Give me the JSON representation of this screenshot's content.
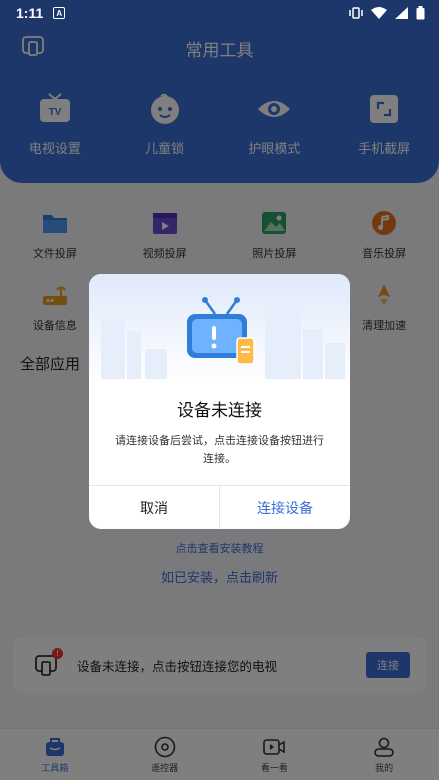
{
  "status": {
    "time": "1:11"
  },
  "header": {
    "title": "常用工具",
    "quick_tools": [
      {
        "label": "电视设置",
        "icon": "tv-icon"
      },
      {
        "label": "儿童锁",
        "icon": "child-face-icon"
      },
      {
        "label": "护眼模式",
        "icon": "eye-icon"
      },
      {
        "label": "手机截屏",
        "icon": "screenshot-icon"
      }
    ]
  },
  "grid": {
    "row1": [
      {
        "label": "文件投屏",
        "icon": "folder-icon"
      },
      {
        "label": "视频投屏",
        "icon": "video-icon"
      },
      {
        "label": "照片投屏",
        "icon": "photo-icon"
      },
      {
        "label": "音乐投屏",
        "icon": "music-icon"
      }
    ],
    "row2": [
      {
        "label": "设备信息",
        "icon": "router-icon"
      },
      {
        "label": "清理加速",
        "icon": "rocket-icon"
      }
    ]
  },
  "section": {
    "all_apps": "全部应用"
  },
  "links": {
    "tutorial": "点击查看安装教程",
    "refresh": "如已安装，点击刷新"
  },
  "connect_bar": {
    "message": "设备未连接，点击按钮连接您的电视",
    "button": "连接",
    "badge": "!"
  },
  "tabbar": [
    {
      "label": "工具箱",
      "icon": "toolbox-icon",
      "active": true
    },
    {
      "label": "遥控器",
      "icon": "remote-icon"
    },
    {
      "label": "看一看",
      "icon": "watch-video-icon"
    },
    {
      "label": "我的",
      "icon": "profile-icon"
    }
  ],
  "dialog": {
    "title": "设备未连接",
    "message": "请连接设备后尝试，点击连接设备按钮进行连接。",
    "cancel": "取消",
    "confirm": "连接设备"
  },
  "colors": {
    "primary": "#3c6fd4",
    "badge": "#ee3333"
  }
}
